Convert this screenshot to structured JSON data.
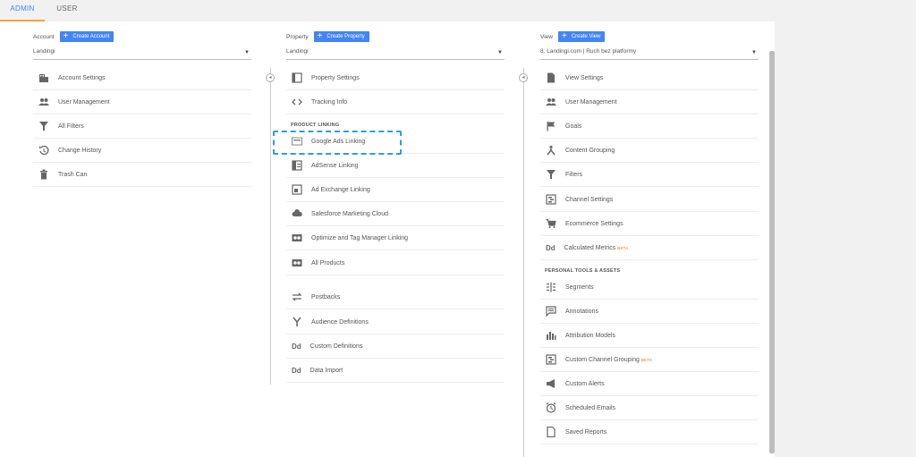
{
  "tabs": {
    "admin": "ADMIN",
    "user": "USER"
  },
  "account": {
    "heading": "Account",
    "create_label": "Create Account",
    "selected": "Landingi",
    "items": [
      "Account Settings",
      "User Management",
      "All Filters",
      "Change History",
      "Trash Can"
    ]
  },
  "property": {
    "heading": "Property",
    "create_label": "Create Property",
    "selected": "Landingi",
    "items": [
      "Property Settings",
      "Tracking Info"
    ],
    "section_title": "PRODUCT LINKING",
    "linking": [
      "Google Ads Linking",
      "AdSense Linking",
      "Ad Exchange Linking",
      "Salesforce Marketing Cloud",
      "Optimize and Tag Manager Linking",
      "All Products"
    ],
    "more": [
      "Postbacks",
      "Audience Definitions",
      "Custom Definitions",
      "Data Import"
    ]
  },
  "view": {
    "heading": "View",
    "create_label": "Create View",
    "selected": "8. Landingi.com | Ruch bez platformy",
    "items": [
      "View Settings",
      "User Management",
      "Goals",
      "Content Grouping",
      "Filters",
      "Channel Settings",
      "Ecommerce Settings",
      "Calculated Metrics"
    ],
    "section_title": "PERSONAL TOOLS & ASSETS",
    "tools": [
      "Segments",
      "Annotations",
      "Attribution Models",
      "Custom Channel Grouping",
      "Custom Alerts",
      "Scheduled Emails",
      "Saved Reports"
    ],
    "beta": "BETA"
  },
  "colors": {
    "accent": "#4285f4",
    "tab_underline": "#f4a23b",
    "highlight": "#2e9fd8",
    "beta": "#e8710a"
  }
}
